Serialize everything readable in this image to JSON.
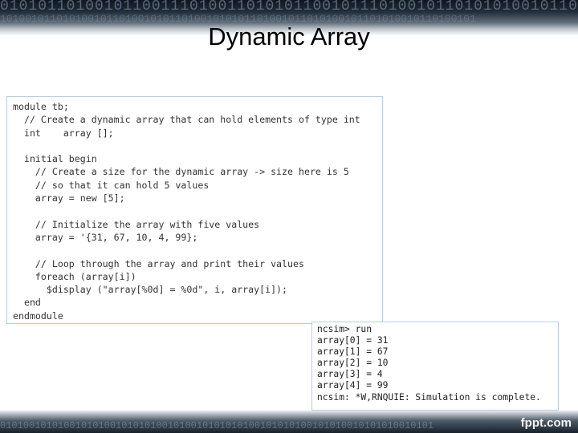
{
  "slide": {
    "title": "Dynamic Array",
    "background_binary_top": "01010110100101100111010011010101100101110100101101010100101101001011010110100101",
    "background_binary_top_2": "1010010110101001011010010101101001010101101001011010100101101010010110100101",
    "background_binary_bottom": "010100101010010101001010101001010010101010100101010100101010010101010010101",
    "brand": "fppt.com"
  },
  "code": {
    "lines": [
      "module tb;",
      "  // Create a dynamic array that can hold elements of type int",
      "  int    array [];",
      "",
      "  initial begin",
      "    // Create a size for the dynamic array -> size here is 5",
      "    // so that it can hold 5 values",
      "    array = new [5];",
      "",
      "    // Initialize the array with five values",
      "    array = '{31, 67, 10, 4, 99};",
      "",
      "    // Loop through the array and print their values",
      "    foreach (array[i])",
      "      $display (\"array[%0d] = %0d\", i, array[i]);",
      "  end",
      "endmodule"
    ]
  },
  "console": {
    "lines": [
      "ncsim> run",
      "array[0] = 31",
      "array[1] = 67",
      "array[2] = 10",
      "array[3] = 4",
      "array[4] = 99",
      "ncsim: *W,RNQUIE: Simulation is complete."
    ]
  }
}
